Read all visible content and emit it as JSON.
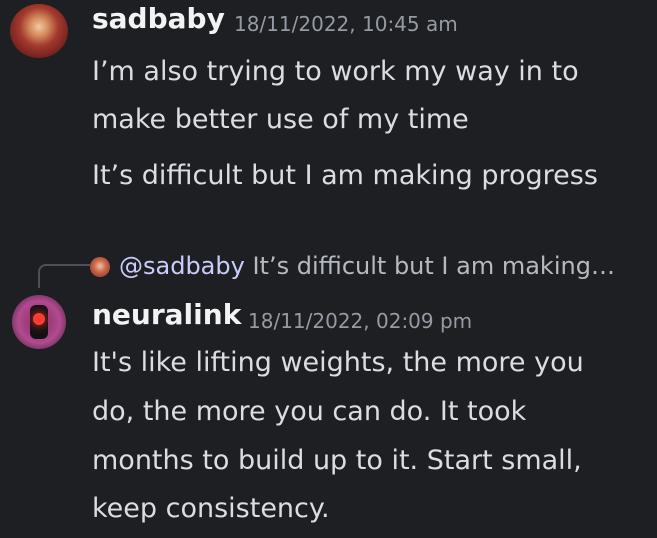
{
  "message1": {
    "username": "sadbaby",
    "timestamp": "18/11/2022, 10:45 am",
    "lines": [
      "I’m also trying to work my way in to",
      "make better use of my time",
      "It’s difficult but I am making progress"
    ]
  },
  "reply": {
    "mention": "@sadbaby",
    "text": "It’s difficult but I am making…"
  },
  "message2": {
    "username": "neuralink",
    "timestamp": "18/11/2022, 02:09 pm",
    "lines": [
      "It's like lifting weights, the more you",
      "do, the more you can do. It took",
      "months to build up to it. Start small,",
      "keep consistency."
    ]
  }
}
